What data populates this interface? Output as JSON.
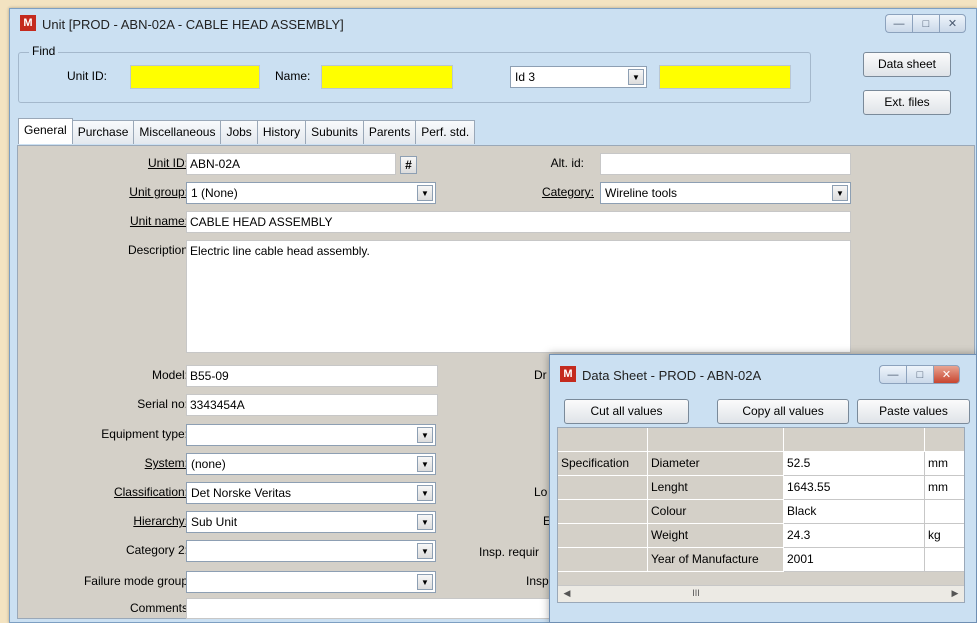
{
  "main_window": {
    "title": "Unit [PROD - ABN-02A  - CABLE HEAD ASSEMBLY]",
    "app_icon": "app-logo-icon",
    "controls": [
      "minimize-icon",
      "maximize-icon",
      "close-icon"
    ]
  },
  "find": {
    "legend": "Find",
    "unit_id_label": "Unit ID:",
    "unit_id_value": "",
    "name_label": "Name:",
    "name_value": "",
    "id_select": "Id 3",
    "id_value": "",
    "highlight_color": "#ffff00"
  },
  "buttons": {
    "data_sheet": "Data sheet",
    "ext_files": "Ext. files"
  },
  "tabs": [
    "General",
    "Purchase",
    "Miscellaneous",
    "Jobs",
    "History",
    "Subunits",
    "Parents",
    "Perf. std."
  ],
  "active_tab": "General",
  "general": {
    "unit_id_label": "Unit ID:",
    "unit_id": "ABN-02A",
    "hash_button": "#",
    "alt_id_label": "Alt. id:",
    "alt_id": "",
    "unit_group_label": "Unit group:",
    "unit_group": "1 (None)",
    "category_label": "Category:",
    "category": "Wireline tools",
    "unit_name_label": "Unit name:",
    "unit_name": "CABLE HEAD ASSEMBLY",
    "description_label": "Description",
    "description": "Electric line cable head assembly.",
    "model_label": "Model:",
    "model": "B55-09",
    "serial_label": "Serial no:",
    "serial": "3343454A",
    "equipment_type_label": "Equipment type:",
    "equipment_type": "",
    "system_label": "System:",
    "system": "(none)",
    "classification_label": "Classification:",
    "classification": "Det Norske Veritas",
    "hierarchy_label": "Hierarchy:",
    "hierarchy": "Sub Unit",
    "category2_label": "Category 2:",
    "category2": "",
    "failure_mode_label": "Failure mode group",
    "failure_mode": "",
    "comments_label": "Comments",
    "comments": "",
    "partial_labels": [
      "Dr",
      "Lo",
      "E",
      "Insp. requir",
      "Insp"
    ]
  },
  "data_sheet": {
    "title": "Data Sheet - PROD - ABN-02A",
    "cut": "Cut all values",
    "copy": "Copy all values",
    "paste": "Paste values",
    "group": "Specification",
    "rows": [
      {
        "name": "Diameter",
        "value": "52.5",
        "unit": "mm"
      },
      {
        "name": "Lenght",
        "value": "1643.55",
        "unit": "mm"
      },
      {
        "name": "Colour",
        "value": "Black",
        "unit": ""
      },
      {
        "name": "Weight",
        "value": "24.3",
        "unit": "kg"
      },
      {
        "name": "Year of Manufacture",
        "value": "2001",
        "unit": ""
      }
    ],
    "scroll_thumb": "III"
  }
}
